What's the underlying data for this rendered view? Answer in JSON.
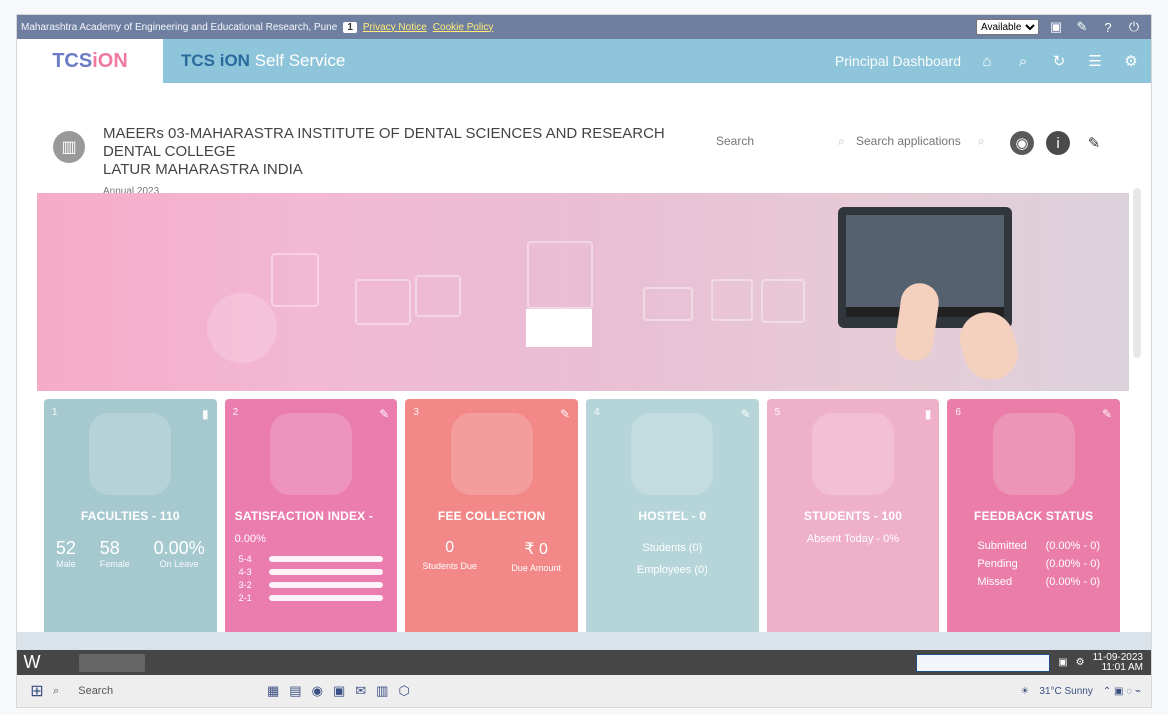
{
  "top_strip": {
    "title": "Maharashtra Academy of Engineering and Educational Research, Pune",
    "page_counter": "1",
    "privacy_link": "Privacy Notice",
    "cookie_link": "Cookie Policy",
    "language_select": "Available"
  },
  "appbar": {
    "logo_text": "iON",
    "self_service_prefix": "TCS iON",
    "self_service_suffix": "Self Service",
    "dashboard_label": "Principal Dashboard"
  },
  "header": {
    "org_name_line1": "MAEERs 03-MAHARASTRA INSTITUTE OF DENTAL SCIENCES AND RESEARCH DENTAL COLLEGE",
    "org_name_line2": "LATUR MAHARASTRA INDIA",
    "academic_year": "Annual 2023",
    "search_1_placeholder": "Search",
    "search_2_placeholder": "Search applications"
  },
  "cards": {
    "faculties": {
      "title": "FACULTIES - 110",
      "stats": [
        {
          "value": "52",
          "label": "Male"
        },
        {
          "value": "58",
          "label": "Female"
        },
        {
          "value": "0.00%",
          "label": "On Leave"
        }
      ]
    },
    "satisfaction": {
      "title": "SATISFACTION INDEX -",
      "subtitle": "0.00%"
    },
    "fee": {
      "title": "FEE COLLECTION",
      "students_due_value": "0",
      "amount_value": "₹ 0",
      "students_due_label": "Students Due",
      "amount_label": "Due Amount"
    },
    "hostel": {
      "title": "HOSTEL - 0",
      "line1": "Students (0)",
      "line2": "Employees (0)"
    },
    "students": {
      "title": "STUDENTS - 100",
      "line1": "Absent Today - 0%"
    },
    "feedback": {
      "title": "FEEDBACK STATUS",
      "rows": [
        {
          "label": "Submitted",
          "value": "(0.00% - 0)"
        },
        {
          "label": "Pending",
          "value": "(0.00% - 0)"
        },
        {
          "label": "Missed",
          "value": "(0.00% - 0)"
        }
      ]
    }
  },
  "taskbar": {
    "time": "11:01 AM",
    "date": "11-09-2023",
    "weather": "31°C Sunny",
    "search": "Search"
  }
}
